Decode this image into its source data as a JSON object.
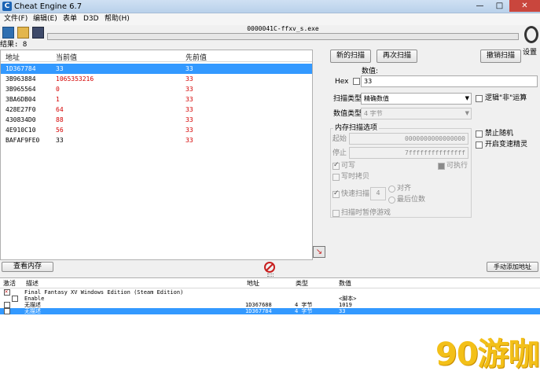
{
  "window": {
    "title": "Cheat Engine 6.7",
    "minimize_glyph": "—",
    "maximize_glyph": "□",
    "close_glyph": "✕"
  },
  "menu": [
    "文件(F)",
    "编辑(E)",
    "表单",
    "D3D",
    "帮助(H)"
  ],
  "toolbar": {
    "process_name": "0000041C-ffxv_s.exe",
    "settings_label": "设置"
  },
  "results": {
    "count_text": "结果: 8",
    "columns": [
      "地址",
      "当前值",
      "先前值"
    ],
    "rows": [
      {
        "address": "1D367784",
        "current": "33",
        "previous": "33",
        "changed": false,
        "selected": true
      },
      {
        "address": "3B963884",
        "current": "1065353216",
        "previous": "33",
        "changed": true,
        "selected": false
      },
      {
        "address": "3B965564",
        "current": "0",
        "previous": "33",
        "changed": true,
        "selected": false
      },
      {
        "address": "3BA6DB04",
        "current": "1",
        "previous": "33",
        "changed": true,
        "selected": false
      },
      {
        "address": "428E27F0",
        "current": "64",
        "previous": "33",
        "changed": true,
        "selected": false
      },
      {
        "address": "430834D0",
        "current": "88",
        "previous": "33",
        "changed": true,
        "selected": false
      },
      {
        "address": "4E910C10",
        "current": "56",
        "previous": "33",
        "changed": true,
        "selected": false
      },
      {
        "address": "BAFAF9FE0",
        "current": "33",
        "previous": "33",
        "changed": false,
        "selected": false
      }
    ]
  },
  "scan": {
    "new_scan": "新的扫描",
    "next_scan": "再次扫描",
    "undo_scan": "撤销扫描",
    "value_label": "数值:",
    "hex_label": "Hex",
    "value": "33",
    "scan_type_label": "扫描类型",
    "scan_type": "精确数值",
    "value_type_label": "数值类型",
    "value_type": "4 字节",
    "not_label": "逻辑\"非\"运算",
    "disable_random": "禁止随机",
    "speedhack": "开启变速精灵",
    "memory_options_title": "内存扫描选项",
    "start_label": "起始",
    "start_value": "0000000000000000",
    "stop_label": "停止",
    "stop_value": "7fffffffffffffff",
    "writable": "可写",
    "executable": "可执行",
    "copy_on_write": "写时拷贝",
    "fast_scan": "快速扫描",
    "fast_scan_value": "4",
    "align": "对齐",
    "last_digits": "最后位数",
    "pause_game": "扫描时暂停游戏"
  },
  "bottom": {
    "view_memory": "查看内存",
    "add_address": "手动添加地址"
  },
  "address_list": {
    "columns": [
      "激活",
      "描述",
      "地址",
      "类型",
      "数值"
    ],
    "rows": [
      {
        "description": "Final Fantasy XV Windows Edition (Steam Edition)",
        "address": "",
        "type": "",
        "value": "",
        "checked": true,
        "indent": 0,
        "selected": false
      },
      {
        "description": "Enable",
        "address": "",
        "type": "",
        "value": "<脚本>",
        "checked": false,
        "indent": 1,
        "selected": false
      },
      {
        "description": "无描述",
        "address": "1D367688",
        "type": "4 字节",
        "value": "1019",
        "checked": false,
        "indent": 0,
        "selected": false
      },
      {
        "description": "无描述",
        "address": "1D367784",
        "type": "4 字节",
        "value": "33",
        "checked": false,
        "indent": 0,
        "selected": true
      }
    ]
  },
  "watermark": "90游咖",
  "colors": {
    "selection": "#3399ff",
    "changed_value": "#d40000",
    "close_button": "#c9463d",
    "watermark": "#f3c018"
  }
}
